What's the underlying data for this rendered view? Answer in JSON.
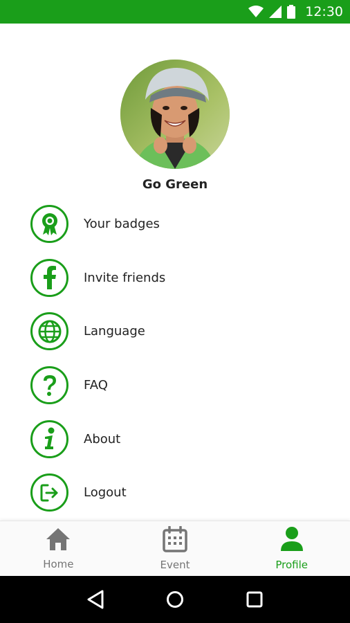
{
  "status_bar": {
    "time": "12:30",
    "icons": [
      "wifi-icon",
      "signal-icon",
      "battery-icon"
    ],
    "color": "#1a9e1a"
  },
  "profile": {
    "name": "Go Green"
  },
  "menu": {
    "items": [
      {
        "label": "Your badges",
        "icon": "badge-ribbon-icon"
      },
      {
        "label": "Invite friends",
        "icon": "facebook-icon"
      },
      {
        "label": "Language",
        "icon": "globe-icon"
      },
      {
        "label": "FAQ",
        "icon": "question-icon"
      },
      {
        "label": "About",
        "icon": "info-icon"
      },
      {
        "label": "Logout",
        "icon": "logout-icon"
      }
    ],
    "accent": "#1a9e1a"
  },
  "bottom_nav": {
    "items": [
      {
        "label": "Home",
        "icon": "home-icon",
        "active": false
      },
      {
        "label": "Event",
        "icon": "calendar-icon",
        "active": false
      },
      {
        "label": "Profile",
        "icon": "person-icon",
        "active": true
      }
    ]
  },
  "system_nav": {
    "buttons": [
      "back-icon",
      "home-circle-icon",
      "recents-icon"
    ]
  }
}
